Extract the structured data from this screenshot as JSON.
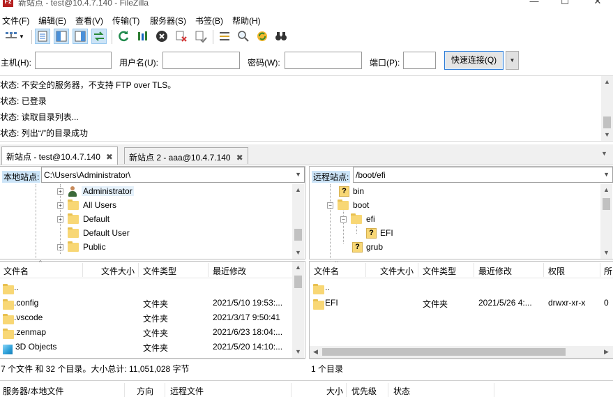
{
  "window": {
    "title": "新站点 - test@10.4.7.140 - FileZilla",
    "app_icon": "Fz"
  },
  "menu": [
    "文件(F)",
    "编辑(E)",
    "查看(V)",
    "传输(T)",
    "服务器(S)",
    "书签(B)",
    "帮助(H)"
  ],
  "quickconnect": {
    "host_label": "主机(H):",
    "host_value": "",
    "user_label": "用户名(U):",
    "user_value": "",
    "pass_label": "密码(W):",
    "pass_value": "",
    "port_label": "端口(P):",
    "port_value": "",
    "button": "快速连接(Q)"
  },
  "log": [
    {
      "label": "状态:",
      "text": "不安全的服务器，不支持 FTP over TLS。"
    },
    {
      "label": "状态:",
      "text": "已登录"
    },
    {
      "label": "状态:",
      "text": "读取目录列表..."
    },
    {
      "label": "状态:",
      "text": "列出“/”的目录成功"
    }
  ],
  "tabs": [
    {
      "label": "新站点 - test@10.4.7.140",
      "close": "✖"
    },
    {
      "label": "新站点 2 - aaa@10.4.7.140",
      "close": "✖"
    }
  ],
  "local": {
    "site_label": "本地站点:",
    "path": "C:\\Users\\Administrator\\",
    "tree": [
      {
        "name": "Administrator",
        "icon": "user-icon",
        "selected": true
      },
      {
        "name": "All Users",
        "icon": "folder-icon"
      },
      {
        "name": "Default",
        "icon": "folder-icon"
      },
      {
        "name": "Default User",
        "icon": "folder-icon"
      },
      {
        "name": "Public",
        "icon": "folder-icon"
      }
    ],
    "columns": [
      "文件名",
      "文件大小",
      "文件类型",
      "最近修改"
    ],
    "files": [
      {
        "name": "..",
        "size": "",
        "type": "",
        "modified": ""
      },
      {
        "name": ".config",
        "size": "",
        "type": "文件夹",
        "modified": "2021/5/10 19:53:..."
      },
      {
        "name": ".vscode",
        "size": "",
        "type": "文件夹",
        "modified": "2021/3/17 9:50:41"
      },
      {
        "name": ".zenmap",
        "size": "",
        "type": "文件夹",
        "modified": "2021/6/23 18:04:..."
      },
      {
        "name": "3D Objects",
        "size": "",
        "type": "文件夹",
        "modified": "2021/5/20 14:10:...",
        "icon": "3d-objects-icon"
      }
    ],
    "status": "7 个文件 和 32 个目录。大小总计: 11,051,028 字节"
  },
  "remote": {
    "site_label": "远程站点:",
    "path": "/boot/efi",
    "tree": [
      {
        "name": "bin",
        "icon": "unknown-folder-icon"
      },
      {
        "name": "boot",
        "icon": "folder-icon"
      },
      {
        "name": "efi",
        "icon": "folder-icon"
      },
      {
        "name": "EFI",
        "icon": "unknown-folder-icon"
      },
      {
        "name": "grub",
        "icon": "unknown-folder-icon"
      }
    ],
    "columns": [
      "文件名",
      "文件大小",
      "文件类型",
      "最近修改",
      "权限",
      "所"
    ],
    "files": [
      {
        "name": "..",
        "size": "",
        "type": "",
        "modified": "",
        "perms": "",
        "owner": ""
      },
      {
        "name": "EFI",
        "size": "",
        "type": "文件夹",
        "modified": "2021/5/26 4:...",
        "perms": "drwxr-xr-x",
        "owner": "0 "
      }
    ],
    "status": "1 个目录"
  },
  "queue": {
    "columns": [
      "服务器/本地文件",
      "方向",
      "远程文件",
      "大小",
      "优先级",
      "状态"
    ]
  }
}
